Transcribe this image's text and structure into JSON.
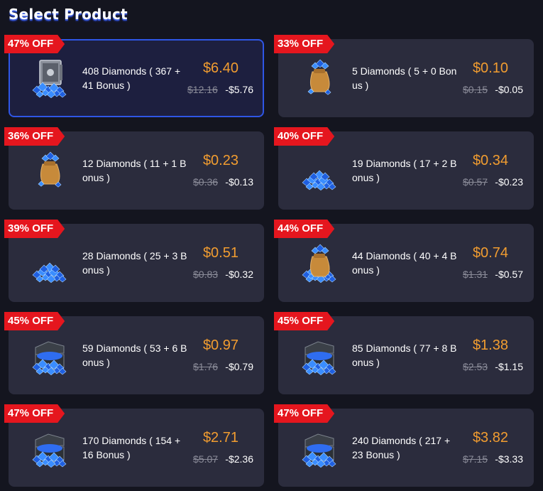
{
  "page": {
    "title": "Select Product"
  },
  "products": [
    {
      "discount": "47% OFF",
      "name": "408 Diamonds ( 367 + 41 Bonus )",
      "price": "$6.40",
      "original_price": "$12.16",
      "savings": "-$5.76",
      "icon": "diamond-safe-icon",
      "selected": true
    },
    {
      "discount": "33% OFF",
      "name": "5 Diamonds ( 5 + 0 Bonus )",
      "price": "$0.10",
      "original_price": "$0.15",
      "savings": "-$0.05",
      "icon": "diamond-bag-icon",
      "selected": false
    },
    {
      "discount": "36% OFF",
      "name": "12 Diamonds ( 11 + 1 Bonus )",
      "price": "$0.23",
      "original_price": "$0.36",
      "savings": "-$0.13",
      "icon": "diamond-bag-icon",
      "selected": false
    },
    {
      "discount": "40% OFF",
      "name": "19 Diamonds ( 17 + 2 Bonus )",
      "price": "$0.34",
      "original_price": "$0.57",
      "savings": "-$0.23",
      "icon": "diamond-pile-icon",
      "selected": false
    },
    {
      "discount": "39% OFF",
      "name": "28 Diamonds ( 25 + 3 Bonus )",
      "price": "$0.51",
      "original_price": "$0.83",
      "savings": "-$0.32",
      "icon": "diamond-pile-icon",
      "selected": false
    },
    {
      "discount": "44% OFF",
      "name": "44 Diamonds ( 40 + 4 Bonus )",
      "price": "$0.74",
      "original_price": "$1.31",
      "savings": "-$0.57",
      "icon": "diamond-bag-pile-icon",
      "selected": false
    },
    {
      "discount": "45% OFF",
      "name": "59 Diamonds ( 53 + 6 Bonus )",
      "price": "$0.97",
      "original_price": "$1.76",
      "savings": "-$0.79",
      "icon": "diamond-chest-icon",
      "selected": false
    },
    {
      "discount": "45% OFF",
      "name": "85 Diamonds ( 77 + 8 Bonus )",
      "price": "$1.38",
      "original_price": "$2.53",
      "savings": "-$1.15",
      "icon": "diamond-chest-icon",
      "selected": false
    },
    {
      "discount": "47% OFF",
      "name": "170 Diamonds ( 154 + 16 Bonus )",
      "price": "$2.71",
      "original_price": "$5.07",
      "savings": "-$2.36",
      "icon": "diamond-chest-icon",
      "selected": false
    },
    {
      "discount": "47% OFF",
      "name": "240 Diamonds ( 217 + 23 Bonus )",
      "price": "$3.82",
      "original_price": "$7.15",
      "savings": "-$3.33",
      "icon": "diamond-chest-icon",
      "selected": false
    }
  ],
  "colors": {
    "background": "#14151f",
    "card": "#2b2c3d",
    "selected_card": "#1d1f3f",
    "selected_border": "#2f56e6",
    "badge": "#e5161e",
    "price": "#f29d30",
    "diamond": "#2f7df0"
  }
}
